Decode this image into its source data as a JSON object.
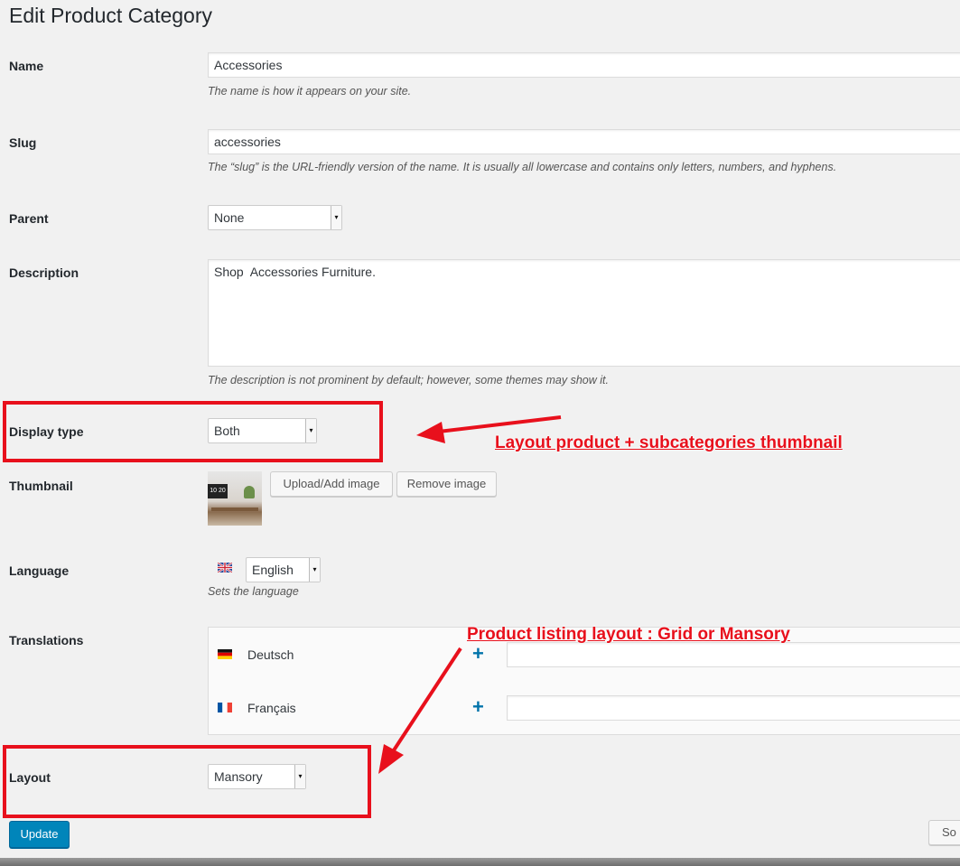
{
  "page": {
    "title": "Edit Product Category"
  },
  "fields": {
    "name": {
      "label": "Name",
      "value": "Accessories",
      "help": "The name is how it appears on your site."
    },
    "slug": {
      "label": "Slug",
      "value": "accessories",
      "help": "The “slug” is the URL-friendly version of the name. It is usually all lowercase and contains only letters, numbers, and hyphens."
    },
    "parent": {
      "label": "Parent",
      "value": "None"
    },
    "description": {
      "label": "Description",
      "value": "Shop  Accessories Furniture.",
      "help": "The description is not prominent by default; however, some themes may show it."
    },
    "display_type": {
      "label": "Display type",
      "value": "Both"
    },
    "thumbnail": {
      "label": "Thumbnail",
      "upload_label": "Upload/Add image",
      "remove_label": "Remove image",
      "thumb_text": "10 20"
    },
    "language": {
      "label": "Language",
      "value": "English",
      "help": "Sets the language"
    },
    "translations": {
      "label": "Translations",
      "items": [
        {
          "language": "Deutsch",
          "add": "+"
        },
        {
          "language": "Français",
          "add": "+"
        }
      ]
    },
    "layout": {
      "label": "Layout",
      "value": "Mansory"
    }
  },
  "actions": {
    "update_label": "Update",
    "secondary_partial": "So"
  },
  "annotations": {
    "display_type_note": "Layout product + subcategories thumbnail",
    "layout_note": "Product listing layout : Grid or Mansory"
  },
  "colors": {
    "annotation": "#e8101c",
    "primary": "#0085ba",
    "link": "#0073aa"
  }
}
